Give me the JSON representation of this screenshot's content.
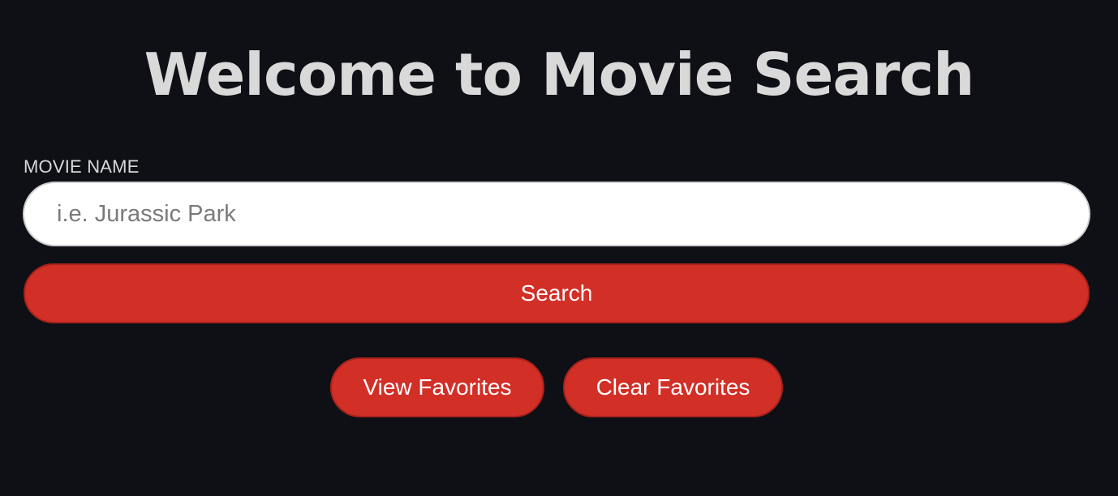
{
  "header": {
    "title": "Welcome to Movie Search"
  },
  "search": {
    "label": "MOVIE NAME",
    "value": "",
    "placeholder": "i.e. Jurassic Park",
    "button_label": "Search"
  },
  "favorites": {
    "view_label": "View Favorites",
    "clear_label": "Clear Favorites"
  },
  "colors": {
    "background": "#0e1016",
    "accent": "#d22f27",
    "title_text": "#d9d9d9"
  }
}
